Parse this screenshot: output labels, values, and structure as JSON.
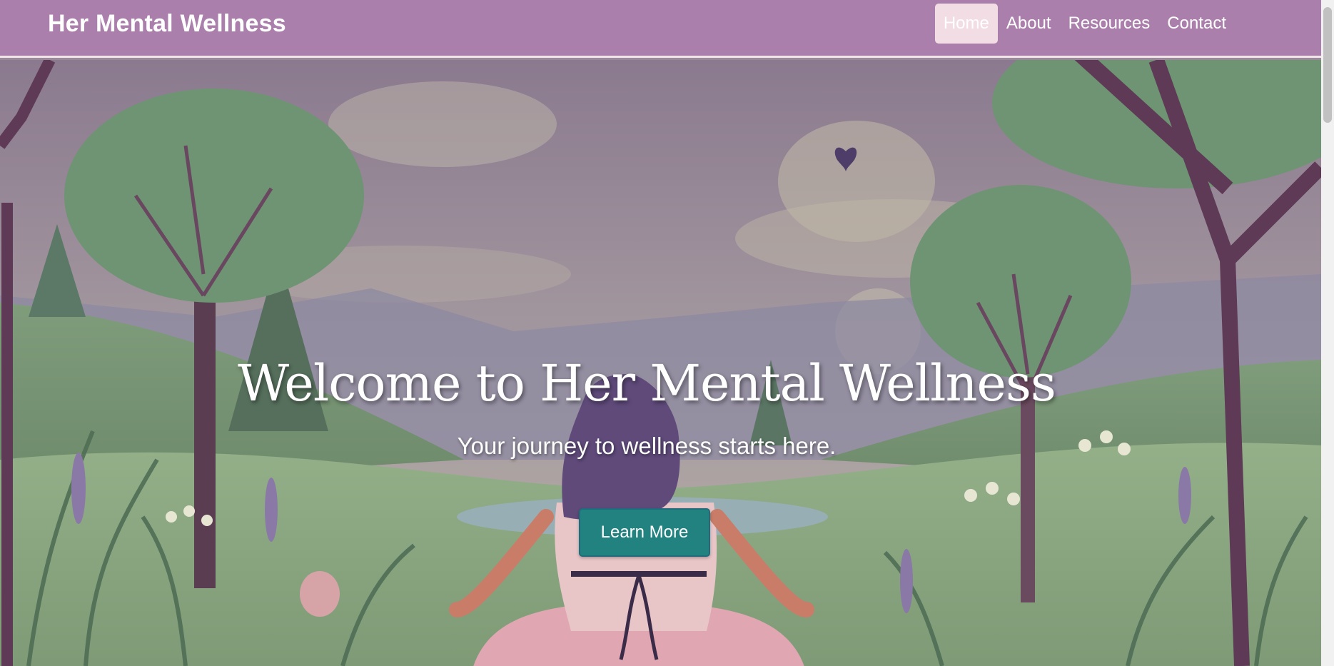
{
  "header": {
    "brand": "Her Mental Wellness",
    "nav": [
      {
        "label": "Home",
        "active": true
      },
      {
        "label": "About",
        "active": false
      },
      {
        "label": "Resources",
        "active": false
      },
      {
        "label": "Contact",
        "active": false
      }
    ]
  },
  "hero": {
    "title": "Welcome to Her Mental Wellness",
    "subtitle": "Your journey to wellness starts here.",
    "cta_label": "Learn More",
    "background": "illustration-woman-meditating-in-meadow"
  },
  "colors": {
    "navbar": "#ab7fac",
    "active_tab": "#f2dde4",
    "cta": "#22827f",
    "sky": "#9b8a9b",
    "grass": "#8aa57f"
  }
}
